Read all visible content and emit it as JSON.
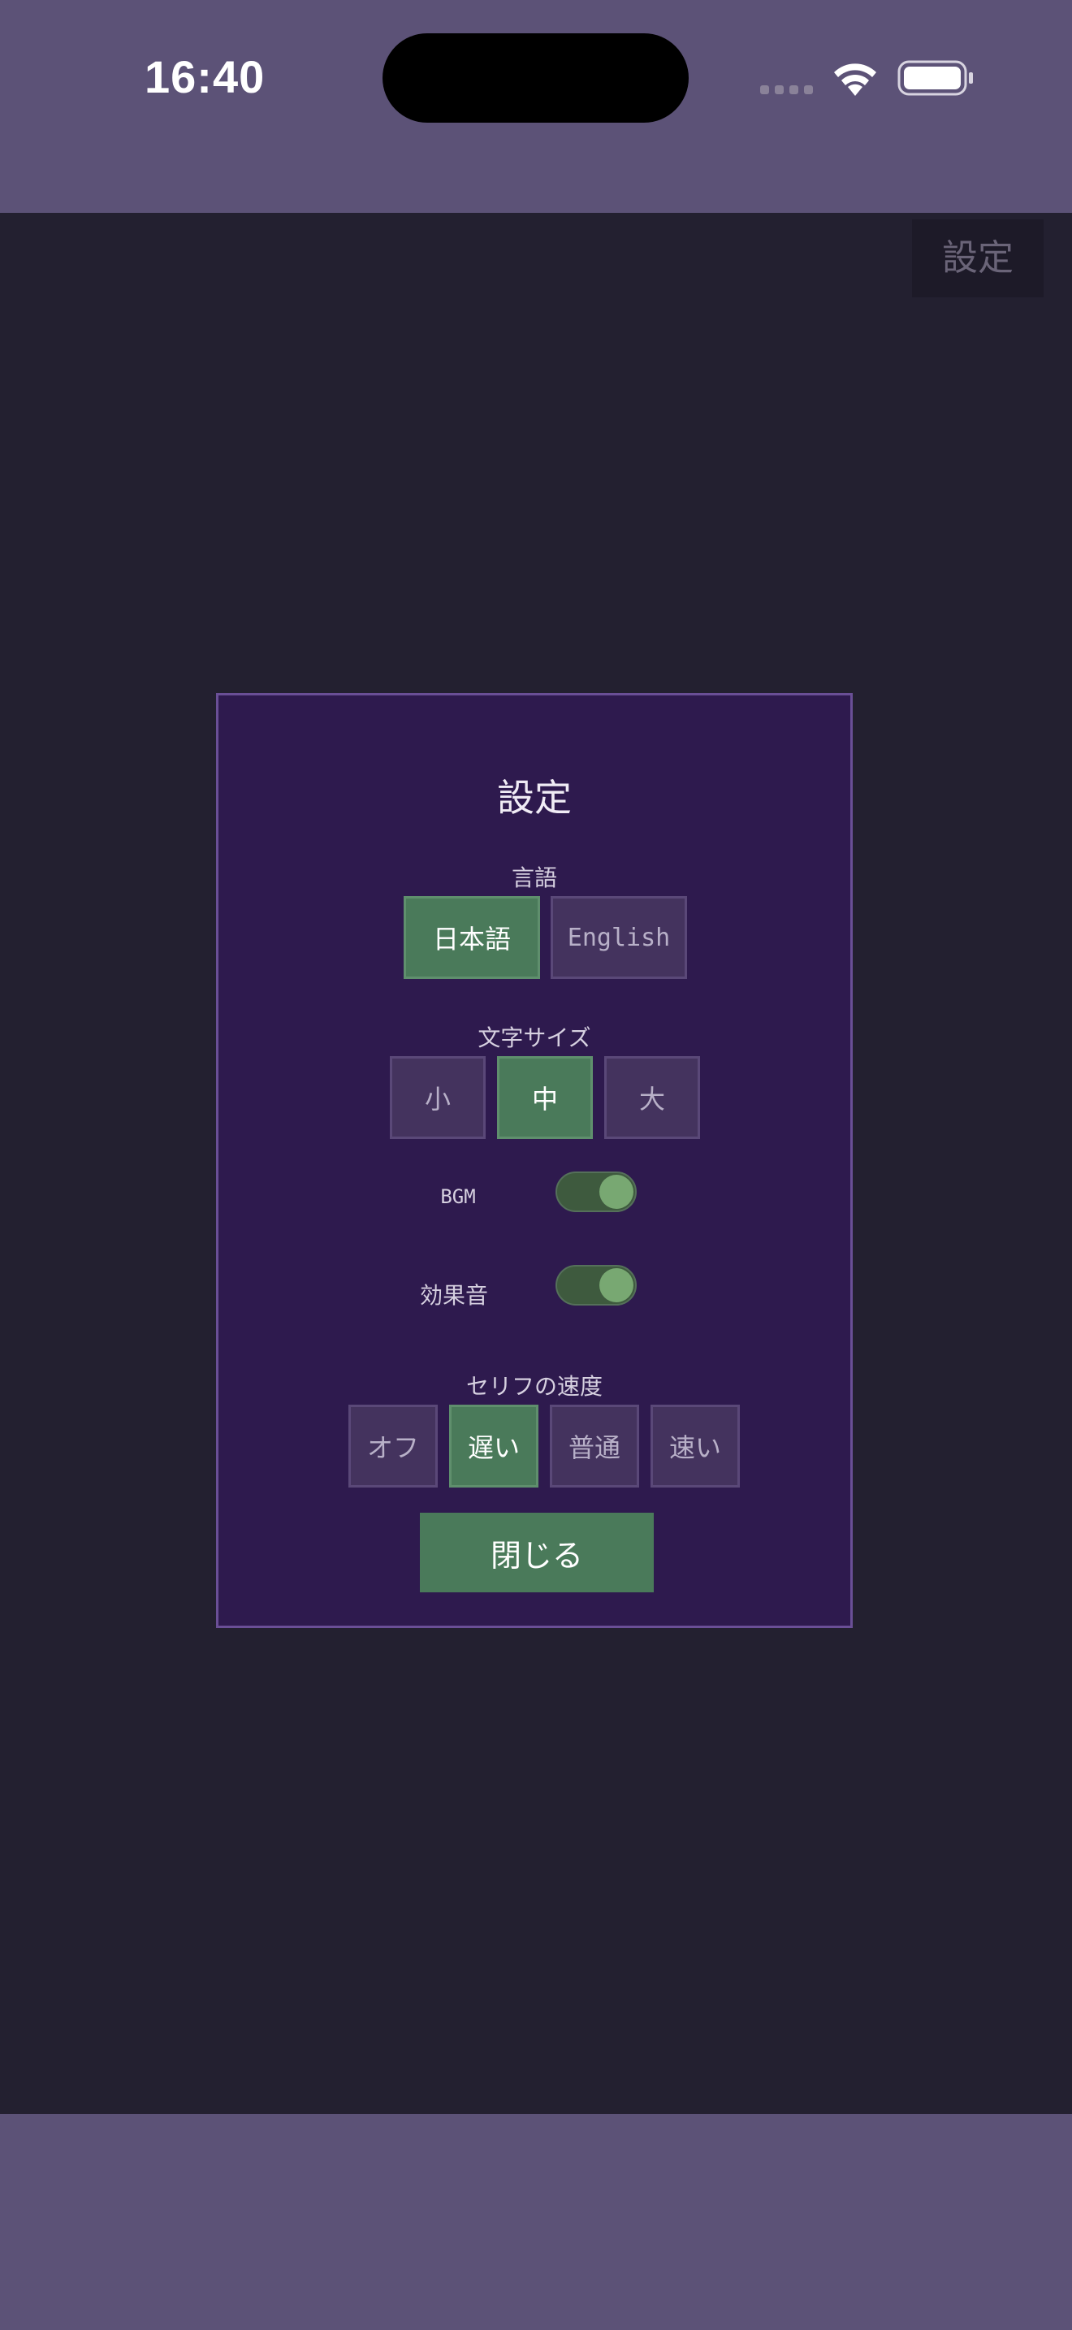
{
  "status_bar": {
    "time": "16:40"
  },
  "game": {
    "settings_button_label": "設定"
  },
  "dialog": {
    "title": "設定",
    "language": {
      "label": "言語",
      "options": [
        "日本語",
        "English"
      ],
      "selected": "日本語"
    },
    "text_size": {
      "label": "文字サイズ",
      "options": [
        "小",
        "中",
        "大"
      ],
      "selected": "中"
    },
    "bgm": {
      "label": "BGM",
      "on": true
    },
    "sound_effects": {
      "label": "効果音",
      "on": true
    },
    "dialogue_speed": {
      "label": "セリフの速度",
      "options": [
        "オフ",
        "遅い",
        "普通",
        "速い"
      ],
      "selected": "遅い"
    },
    "close_label": "閉じる"
  },
  "colors": {
    "status_bar_bg": "#5c5277",
    "game_bg": "#232030",
    "dialog_bg": "#2e1a4e",
    "dialog_border": "#6a4f96",
    "selected_green": "#4a7a5a",
    "option_bg": "#44335e"
  }
}
